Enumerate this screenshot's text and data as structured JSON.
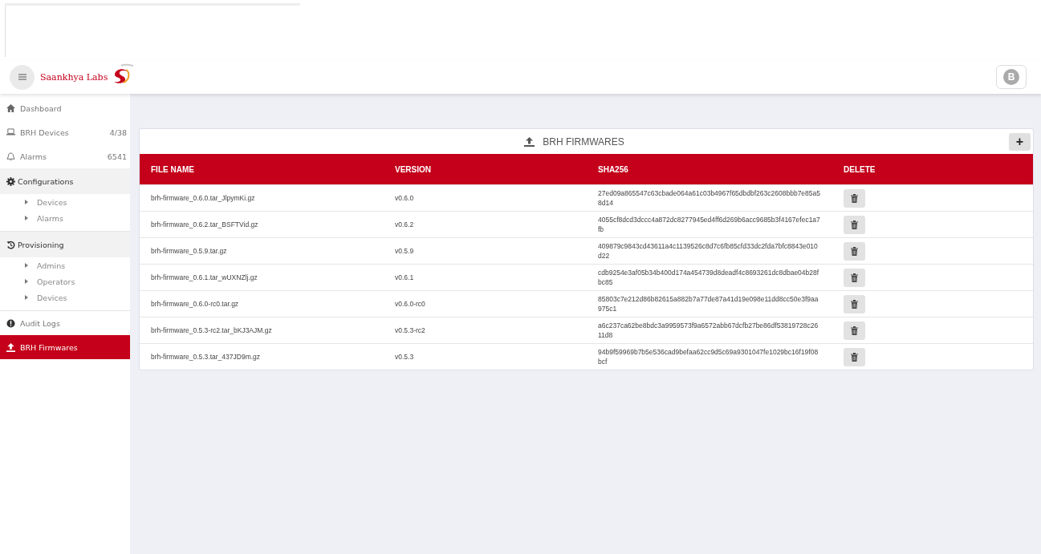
{
  "header": {
    "brand": "Saankhya Labs",
    "avatar": "B"
  },
  "sidebar": {
    "items": [
      {
        "kind": "link",
        "label": "Dashboard",
        "selected": false
      },
      {
        "kind": "link",
        "label": "BRH Devices",
        "count": "4/38",
        "selected": false
      },
      {
        "kind": "link",
        "label": "Alarms",
        "count": "6541",
        "selected": false
      },
      {
        "kind": "section",
        "label": "Configurations",
        "selected": false,
        "children": [
          {
            "label": "Devices",
            "selected": false
          },
          {
            "label": "Alarms",
            "selected": false
          }
        ]
      },
      {
        "kind": "section",
        "label": "Provisioning",
        "selected": false,
        "children": [
          {
            "label": "Admins",
            "selected": false
          },
          {
            "label": "Operators",
            "selected": false
          },
          {
            "label": "Devices",
            "selected": false
          }
        ]
      },
      {
        "kind": "link",
        "label": "Audit Logs",
        "selected": false
      },
      {
        "kind": "link",
        "label": "BRH Firmwares",
        "selected": true
      }
    ]
  },
  "card": {
    "title": "BRH FIRMWARES",
    "add_button": "+",
    "table": {
      "columns": [
        "FILE NAME",
        "VERSION",
        "SHA256",
        "DELETE"
      ],
      "rows": [
        {
          "file_name": "brh-firmware_0.6.0.tar_JlpymKi.gz",
          "version": "v0.6.0",
          "sha256": "27ed09a865547c63cbade064a61c03b4967f65dbdbf263c2608bbb7e85a58d14"
        },
        {
          "file_name": "brh-firmware_0.6.2.tar_BSFTVid.gz",
          "version": "v0.6.2",
          "sha256": "4055cf8dcd3dccc4a872dc8277945ed4ff6d269b6acc9685b3f4167efec1a7fb"
        },
        {
          "file_name": "brh-firmware_0.5.9.tar.gz",
          "version": "v0.5.9",
          "sha256": "409879c9843cd43611a4c1139526c8d7c6fb85cfd33dc2fda7bfc8843e010d22"
        },
        {
          "file_name": "brh-firmware_0.6.1.tar_wUXNZlj.gz",
          "version": "v0.6.1",
          "sha256": "cdb9254e3af05b34b400d174a454739d8deadf4c8693261dc8dbae04b28fbc85"
        },
        {
          "file_name": "brh-firmware_0.6.0-rc0.tar.gz",
          "version": "v0.6.0-rc0",
          "sha256": "85803c7e212d86b82615a882b7a77de87a41d19e098e11dd8cc50e3f9aa975c1"
        },
        {
          "file_name": "brh-firmware_0.5.3-rc2.tar_bKJ3AJM.gz",
          "version": "v0.5.3-rc2",
          "sha256": "a6c237ca62be8bdc3a9959573f9a6572abb67dcfb27be86df53819728c2611d8"
        },
        {
          "file_name": "brh-firmware_0.5.3.tar_437JD9m.gz",
          "version": "v0.5.3",
          "sha256": "94b9f59969b7b5e536cad9befaa62cc9d5c69a9301047fe1029bc16f19f08bcf"
        }
      ]
    }
  }
}
